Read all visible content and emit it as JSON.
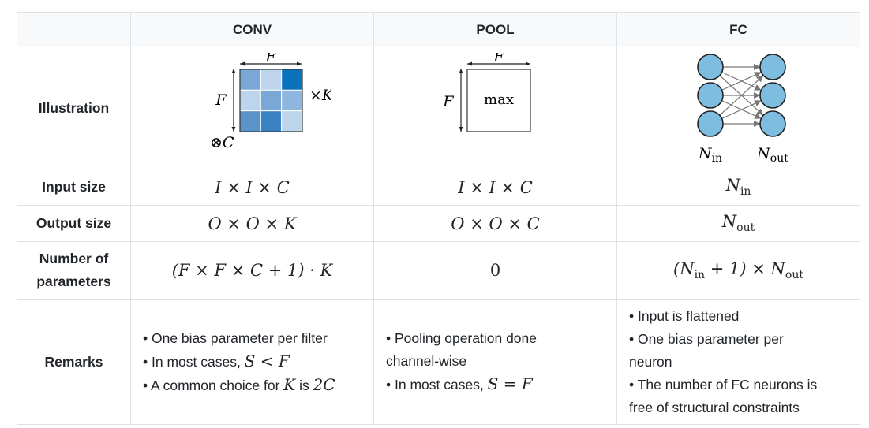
{
  "header": {
    "corner": "",
    "conv": "CONV",
    "pool": "POOL",
    "fc": "FC"
  },
  "rows": {
    "illustration": "Illustration",
    "input_size": "Input size",
    "output_size": "Output size",
    "num_params_line1": "Number of",
    "num_params_line2": "parameters",
    "remarks": "Remarks"
  },
  "illustration": {
    "conv": {
      "filter_top_label": "F",
      "filter_side_label": "F",
      "times_k": "×K",
      "otimes_c": "⊗C",
      "cell_colors": [
        "#7aa8d6",
        "#bcd5ec",
        "#0b71bb",
        "#bcd5ec",
        "#7aa8d6",
        "#8fb6de",
        "#5b93cb",
        "#3a82c4",
        "#bcd5ec"
      ]
    },
    "pool": {
      "top_label": "F",
      "side_label": "F",
      "center_text": "max"
    },
    "fc": {
      "n_in_base": "N",
      "n_in_sub": "in",
      "n_out_base": "N",
      "n_out_sub": "out",
      "node_color": "#7fbde0"
    }
  },
  "input_size": {
    "conv": "I × I × C",
    "pool": "I × I × C",
    "fc_base": "N",
    "fc_sub": "in"
  },
  "output_size": {
    "conv": "O × O × K",
    "pool": "O × O × C",
    "fc_base": "N",
    "fc_sub": "out"
  },
  "num_params": {
    "conv": "(F × F × C + 1) · K",
    "pool": "0",
    "fc_open": "(N",
    "fc_in_sub": "in",
    "fc_mid": " + 1) × N",
    "fc_out_sub": "out"
  },
  "remarks": {
    "conv": {
      "line1": "• One bias parameter per filter",
      "line2_text": "• In most cases, ",
      "line2_math": "S < F",
      "line3_text_a": "• A common choice for ",
      "line3_math_k": "K",
      "line3_text_b": " is ",
      "line3_math_val": "2C"
    },
    "pool": {
      "line1": "• Pooling operation done",
      "line2": "channel-wise",
      "line3_text": "• In most cases, ",
      "line3_math": "S = F"
    },
    "fc": {
      "line1": "• Input is flattened",
      "line2": "• One bias parameter per",
      "line3": "neuron",
      "line4": "• The number of FC neurons is",
      "line5": "free of structural constraints"
    }
  }
}
